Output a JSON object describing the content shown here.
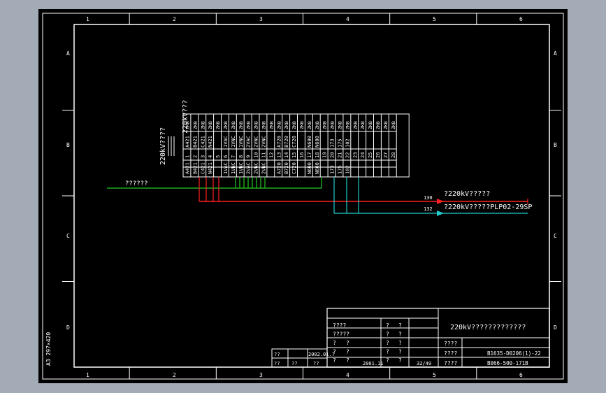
{
  "grid": {
    "columns": [
      "1",
      "2",
      "3",
      "4",
      "5",
      "6"
    ],
    "rows": [
      "A",
      "B",
      "C",
      "D"
    ]
  },
  "sheet_size": "A3 297×420",
  "title_small": "220kV???",
  "title_vertical": "220kV????",
  "terminal_columns": [
    [
      "I4",
      "I4",
      "I4",
      "D",
      "I4"
    ],
    [
      "I4",
      "I4",
      "I4",
      "D",
      "I4"
    ],
    [
      "I4",
      "I4",
      "I4",
      "D",
      "I4"
    ],
    [
      "I4",
      "I4",
      "I4",
      "D",
      "I4"
    ],
    [
      "I4",
      "I4",
      "I4",
      "D",
      "I4"
    ],
    [
      "I4",
      "I4",
      "I4",
      "D",
      "I4"
    ],
    [
      "I4",
      "I4",
      "I4",
      "D",
      "I4"
    ],
    [
      "I4",
      "I4",
      "I4",
      "D",
      "I4"
    ],
    [
      "I4",
      "I4",
      "I4",
      "D",
      "I4"
    ],
    [
      "I4",
      "I4",
      "I4",
      "D",
      "I4"
    ],
    [
      "I4",
      "I4",
      "I4",
      "D",
      "I4"
    ],
    [
      "I4",
      "I4",
      "I4",
      "D",
      "I4"
    ],
    [
      "I4",
      "I4",
      "I4",
      "D",
      "I4"
    ],
    [
      "I4",
      "I4",
      "I4",
      "D",
      "I4"
    ],
    [
      "I4",
      "I4",
      "I4",
      "D",
      "I4"
    ],
    [
      "I4",
      "I4",
      "I4",
      "D",
      "I4"
    ],
    [
      "I4",
      "I4",
      "I4",
      "D",
      "I4"
    ],
    [
      "I4",
      "I4",
      "I4",
      "D",
      "I4"
    ],
    [
      "I4",
      "I4",
      "I4",
      "D",
      "I4"
    ],
    [
      "I4",
      "I4",
      "I4",
      "D",
      "I4"
    ],
    [
      "I4",
      "I4",
      "I4",
      "D",
      "I4"
    ],
    [
      "I4",
      "I4",
      "I4",
      "D",
      "I4"
    ],
    [
      "I4",
      "I4",
      "I4",
      "D",
      "I4"
    ],
    [
      "I4",
      "I4",
      "I4",
      "D",
      "I4"
    ],
    [
      "I4",
      "I4",
      "I4",
      "D",
      "I4"
    ],
    [
      "I4",
      "I4",
      "I4",
      "D",
      "I4"
    ],
    [
      "I4",
      "I4",
      "I4",
      "D",
      "I4"
    ],
    [
      "I4",
      "I4",
      "I4",
      "D",
      "I4"
    ]
  ],
  "terminal_labels": [
    {
      "c": 0,
      "l": [
        "A421",
        "1",
        "A421"
      ]
    },
    {
      "c": 1,
      "l": [
        "B421",
        "2",
        "B421"
      ]
    },
    {
      "c": 2,
      "l": [
        "C421",
        "3",
        "C421"
      ]
    },
    {
      "c": 3,
      "l": [
        "N421",
        "4",
        "N421"
      ]
    },
    {
      "c": 4,
      "l": [
        "5"
      ]
    },
    {
      "c": 5,
      "l": [
        "1VAC",
        "6",
        "1VAC"
      ]
    },
    {
      "c": 6,
      "l": [
        "1VNC",
        "7",
        "1VNC"
      ]
    },
    {
      "c": 7,
      "l": [
        "1VNC",
        "8",
        "1VNC"
      ]
    },
    {
      "c": 8,
      "l": [
        "2VAC",
        "9",
        "2VAC"
      ]
    },
    {
      "c": 9,
      "l": [
        "2VNC",
        "10",
        "2VNC"
      ]
    },
    {
      "c": 10,
      "l": [
        "2VNC",
        "11",
        "2VNC"
      ]
    },
    {
      "c": 11,
      "l": [
        "12"
      ]
    },
    {
      "c": 12,
      "l": [
        "A720",
        "13",
        "A720"
      ]
    },
    {
      "c": 13,
      "l": [
        "B720",
        "14",
        "B720"
      ]
    },
    {
      "c": 14,
      "l": [
        "C720",
        "15",
        "C720"
      ]
    },
    {
      "c": 15,
      "l": [
        "16"
      ]
    },
    {
      "c": 16,
      "l": [
        "N600",
        "17",
        "N600"
      ]
    },
    {
      "c": 17,
      "l": [
        "N600",
        "18",
        "N600"
      ]
    },
    {
      "c": 18,
      "l": [
        "19"
      ]
    },
    {
      "c": 19,
      "l": [
        "173",
        "20",
        "173"
      ]
    },
    {
      "c": 20,
      "l": [
        "175",
        "21",
        "175"
      ]
    },
    {
      "c": 21,
      "l": [
        "102",
        "22",
        "102"
      ]
    },
    {
      "c": 22,
      "l": [
        "23"
      ]
    },
    {
      "c": 23,
      "l": [
        "24"
      ]
    },
    {
      "c": 24,
      "l": [
        "25"
      ]
    },
    {
      "c": 25,
      "l": [
        "26"
      ]
    },
    {
      "c": 26,
      "l": [
        "27"
      ]
    },
    {
      "c": 27,
      "l": [
        "28"
      ]
    }
  ],
  "buses": {
    "green_label": "??????",
    "red_num": "130",
    "red_label": "?220kV?????",
    "cyan_num": "132",
    "cyan_label": "?220kV?????PLP02-29SP"
  },
  "title_block": {
    "drawing_title": "220kV?????????????",
    "rows_left": [
      [
        "????",
        "?",
        "?"
      ],
      [
        "?????",
        "?",
        "?"
      ],
      [
        "?",
        "?",
        "?",
        "?"
      ],
      [
        "?",
        "?",
        "?",
        "?"
      ],
      [
        "?",
        "?",
        "?",
        "?"
      ]
    ],
    "bottom_left": [
      "??",
      "??",
      "??",
      "2002.01.?"
    ],
    "date": "2001.11",
    "sheet": "32/49",
    "codes": [
      {
        "k": "????",
        "v": ""
      },
      {
        "k": "????",
        "v": "B1635-D0206(1)-22"
      },
      {
        "k": "????",
        "v": "B066-500-171B"
      }
    ]
  },
  "colors": {
    "green": "#22cc22",
    "red": "#ff2020",
    "cyan": "#22cccc",
    "line": "#ffffff"
  }
}
